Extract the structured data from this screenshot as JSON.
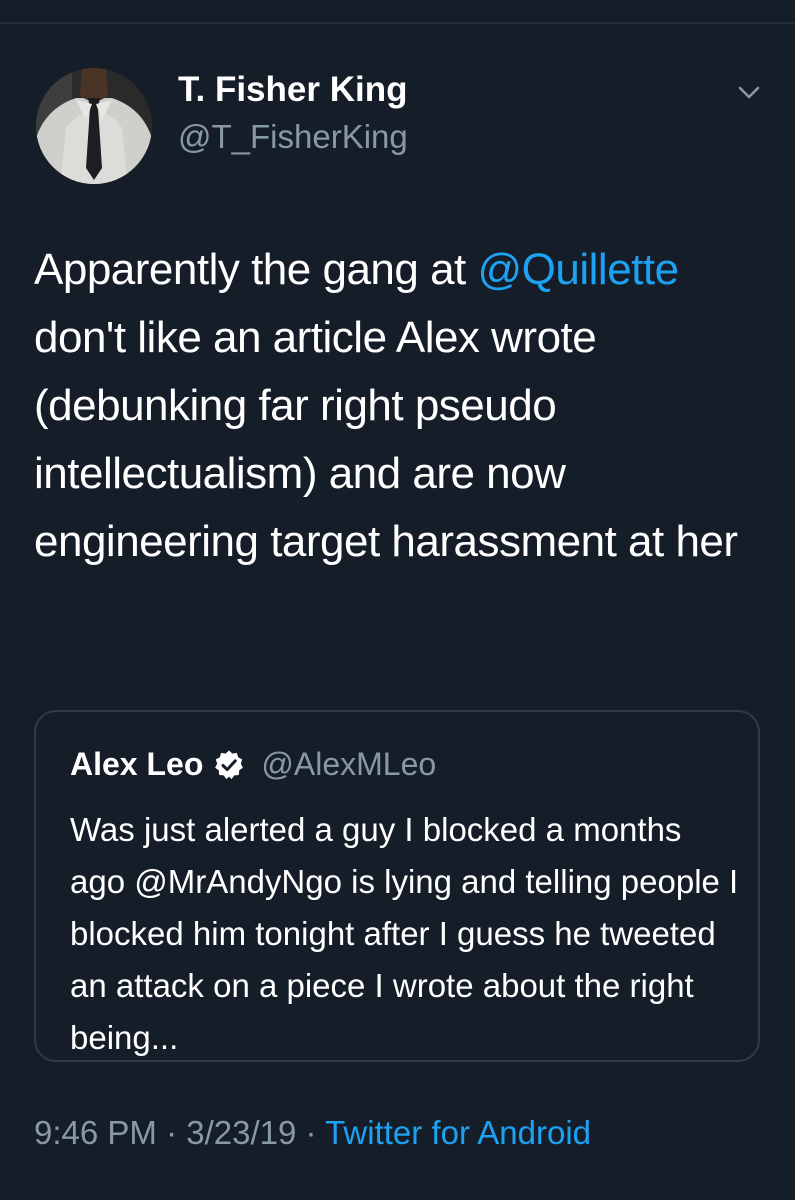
{
  "author": {
    "display_name": "T. Fisher King",
    "handle": "@T_FisherKing"
  },
  "tweet": {
    "text_part1": "Apparently the gang at ",
    "mention": "@Quillette",
    "text_part2": " don't like an article Alex wrote (debunking far right pseudo intellectualism) and are now engineering target harassment at her"
  },
  "quoted_tweet": {
    "display_name": "Alex Leo",
    "handle": "@AlexMLeo",
    "text": "Was just alerted a guy I blocked a months ago @MrAndyNgo is lying and telling people I blocked him tonight after I guess he tweeted an attack on a piece I wrote about the right being..."
  },
  "meta": {
    "time": "9:46 PM",
    "sep1": " · ",
    "date": "3/23/19",
    "sep2": " · ",
    "source": "Twitter for Android"
  },
  "icons": {
    "caret": "chevron-down-icon",
    "verified": "verified-badge-icon"
  },
  "colors": {
    "background": "#151d28",
    "link": "#1da1f2",
    "secondary_text": "#8899a6",
    "border": "#2f3b48"
  }
}
